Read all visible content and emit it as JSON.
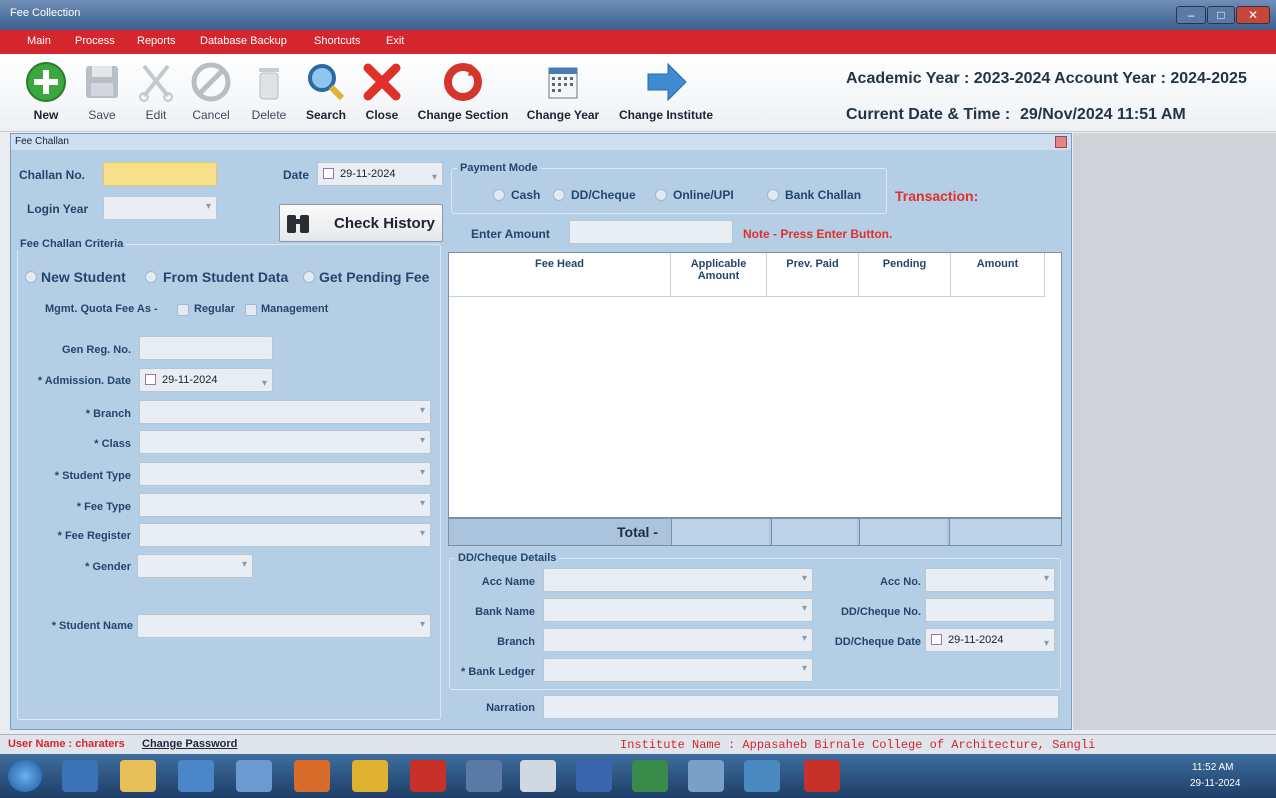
{
  "window": {
    "title": "Fee Collection"
  },
  "menu": [
    "Main",
    "Process",
    "Reports",
    "Database Backup",
    "Shortcuts",
    "Exit"
  ],
  "toolbar": {
    "new": "New",
    "save": "Save",
    "edit": "Edit",
    "cancel": "Cancel",
    "delete": "Delete",
    "search": "Search",
    "close": "Close",
    "change_section": "Change Section",
    "change_year": "Change Year",
    "change_institute": "Change Institute"
  },
  "header": {
    "years": "Academic Year : 2023-2024  Account Year : 2024-2025",
    "datetime_label": "Current Date & Time :",
    "datetime_value": "29/Nov/2024 11:51 AM"
  },
  "panel": {
    "title": "Fee Challan"
  },
  "form": {
    "challan_no": "Challan No.",
    "date_label": "Date",
    "date_value": "29-11-2024",
    "login_year": "Login Year",
    "check_history": "Check History",
    "criteria_title": "Fee Challan Criteria",
    "opt_new_student": "New Student",
    "opt_from_student": "From Student Data",
    "opt_pending": "Get Pending Fee",
    "mgmt_quota": "Mgmt. Quota Fee As -",
    "regular": "Regular",
    "management": "Management",
    "gen_reg_no": "Gen Reg. No.",
    "admission_date": "* Admission. Date",
    "admission_date_value": "29-11-2024",
    "branch": "* Branch",
    "class": "* Class",
    "student_type": "* Student Type",
    "fee_type": "* Fee Type",
    "fee_register": "* Fee Register",
    "gender": "* Gender",
    "student_name": "* Student Name"
  },
  "payment": {
    "title": "Payment Mode",
    "cash": "Cash",
    "dd_cheque": "DD/Cheque",
    "online_upi": "Online/UPI",
    "bank_challan": "Bank Challan",
    "transaction": "Transaction:",
    "enter_amount": "Enter Amount",
    "note": "Note - Press Enter Button."
  },
  "grid": {
    "columns": [
      "Fee Head",
      "Applicable Amount",
      "Prev. Paid",
      "Pending",
      "Amount"
    ],
    "total_label": "Total -"
  },
  "dd": {
    "title": "DD/Cheque Details",
    "acc_name": "Acc Name",
    "acc_no": "Acc No.",
    "bank_name": "Bank Name",
    "dd_cheque_no": "DD/Cheque No.",
    "branch": "Branch",
    "dd_cheque_date": "DD/Cheque Date",
    "dd_cheque_date_value": "29-11-2024",
    "bank_ledger": "* Bank Ledger",
    "narration": "Narration"
  },
  "status": {
    "user": "User Name : charaters",
    "change_password": "Change Password",
    "institute": "Institute Name : Appasaheb Birnale College of Architecture, Sangli"
  },
  "taskbar": {
    "time": "11:52 AM",
    "date": "29-11-2024"
  },
  "colors": {
    "menu_red": "#d5262e",
    "panel_blue": "#b4cfe5",
    "label_blue": "#24456c",
    "note_red": "#e0302a",
    "challan_yellow": "#f6e08a"
  }
}
